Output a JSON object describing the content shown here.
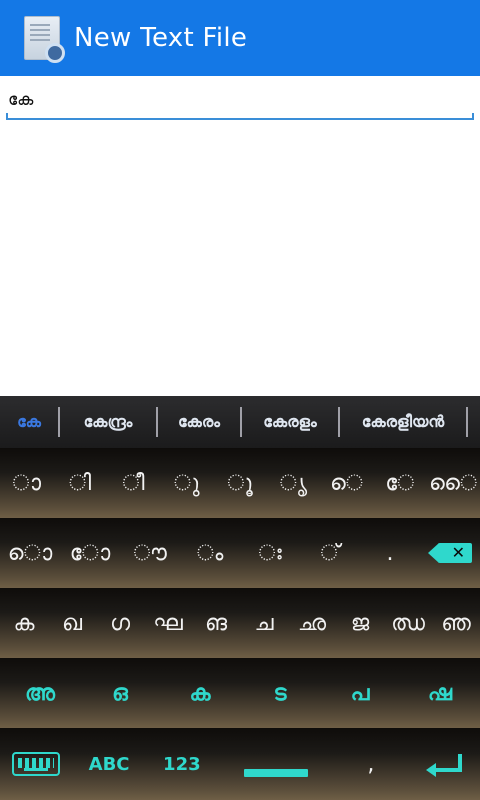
{
  "app_bar": {
    "title": "New Text File"
  },
  "editor": {
    "text": "കേ"
  },
  "suggestions": [
    {
      "label": "കേ"
    },
    {
      "label": "കേന്ദ്രം"
    },
    {
      "label": "കേരം"
    },
    {
      "label": "കേരളം"
    },
    {
      "label": "കേരളീയൻ"
    }
  ],
  "keyboard": {
    "row1": [
      "ാ",
      "ി",
      "ീ",
      "ു",
      "ൂ",
      "ൃ",
      "െ",
      "േ",
      "ൈ"
    ],
    "row2": [
      "ൊ",
      "ോ",
      "ൗ",
      "ം",
      "ഃ",
      "്",
      "."
    ],
    "row3": [
      "ക",
      "ഖ",
      "ഗ",
      "ഘ",
      "ങ",
      "ച",
      "ഛ",
      "ജ",
      "ഝ",
      "ഞ"
    ],
    "row4": [
      "അ",
      "ഒ",
      "ക",
      "ട",
      "പ",
      "ഷ"
    ],
    "row5": {
      "abc": "ABC",
      "num": "123",
      "comma": ","
    }
  },
  "colors": {
    "accent": "#2fd8cc",
    "app_bar": "#1478e6",
    "suggestion_active": "#3a78e0"
  }
}
